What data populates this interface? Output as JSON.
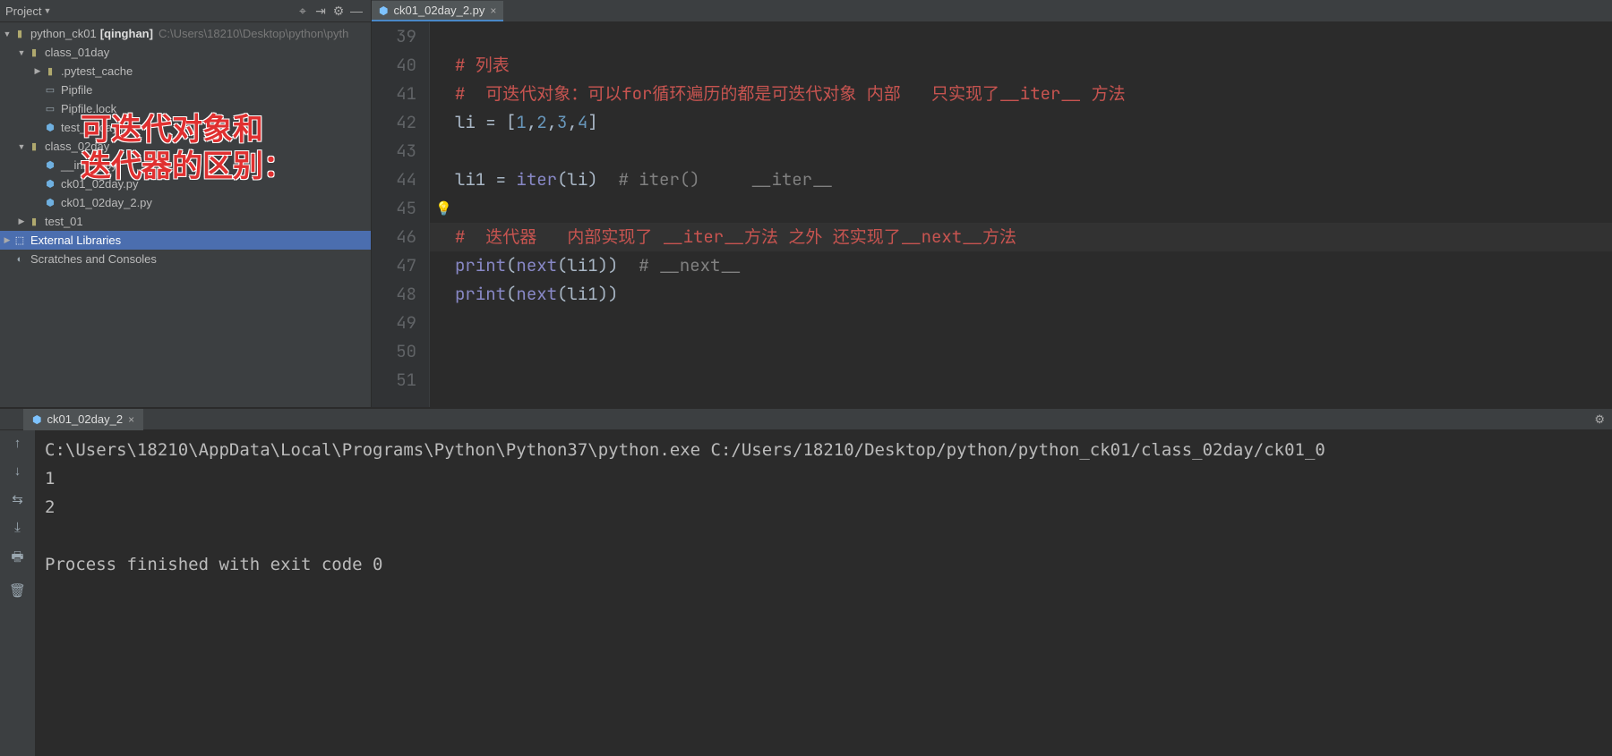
{
  "project_panel": {
    "title": "Project",
    "root": {
      "name": "python_ck01",
      "tag": "[qinghan]",
      "path": "C:\\Users\\18210\\Desktop\\python\\pyth"
    },
    "tree": [
      {
        "indent": 1,
        "arrow": "down",
        "icon": "folder",
        "label": "class_01day"
      },
      {
        "indent": 2,
        "arrow": "right",
        "icon": "folder",
        "label": ".pytest_cache"
      },
      {
        "indent": 2,
        "arrow": "",
        "icon": "file",
        "label": "Pipfile"
      },
      {
        "indent": 2,
        "arrow": "",
        "icon": "file",
        "label": "Pipfile.lock"
      },
      {
        "indent": 2,
        "arrow": "",
        "icon": "py",
        "label": "test_01day.py"
      },
      {
        "indent": 1,
        "arrow": "down",
        "icon": "folder",
        "label": "class_02day"
      },
      {
        "indent": 2,
        "arrow": "",
        "icon": "py",
        "label": "__init__.py"
      },
      {
        "indent": 2,
        "arrow": "",
        "icon": "py",
        "label": "ck01_02day.py"
      },
      {
        "indent": 2,
        "arrow": "",
        "icon": "py",
        "label": "ck01_02day_2.py"
      },
      {
        "indent": 1,
        "arrow": "right",
        "icon": "folder",
        "label": "test_01"
      },
      {
        "indent": 0,
        "arrow": "right",
        "icon": "lib",
        "label": "External Libraries",
        "selected": true
      },
      {
        "indent": 0,
        "arrow": "",
        "icon": "scratch",
        "label": "Scratches and Consoles"
      }
    ],
    "overlay_line1": "可迭代对象和",
    "overlay_line2": "迭代器的区别："
  },
  "editor": {
    "tab_name": "ck01_02day_2.py",
    "lines": {
      "39": "",
      "40": "# 列表",
      "41": "#  可迭代对象：可以for循环遍历的都是可迭代对象 内部   只实现了__iter__ 方法",
      "42_pre": "li ",
      "42_eq": "= ",
      "42_br1": "[",
      "42_n1": "1",
      "42_c1": ",",
      "42_n2": "2",
      "42_c2": ",",
      "42_n3": "3",
      "42_c3": ",",
      "42_n4": "4",
      "42_br2": "]",
      "43": "",
      "44_pre": "li1 ",
      "44_eq": "= ",
      "44_fn": "iter",
      "44_paren": "(li)",
      "44_cmt": "  # iter()     __iter__",
      "45": "",
      "46": "#  迭代器   内部实现了 __iter__方法 之外 还实现了__next__方法",
      "47_pr": "print",
      "47_p1": "(",
      "47_nx": "next",
      "47_p2": "(li1))",
      "47_cmt": "  # __next__",
      "48_pr": "print",
      "48_p1": "(",
      "48_nx": "next",
      "48_p2": "(li1))",
      "49": "",
      "50": "",
      "51": ""
    },
    "gutter": [
      "39",
      "40",
      "41",
      "42",
      "43",
      "44",
      "45",
      "46",
      "47",
      "48",
      "49",
      "50",
      "51"
    ]
  },
  "run": {
    "tab": "ck01_02day_2",
    "lines": [
      "C:\\Users\\18210\\AppData\\Local\\Programs\\Python\\Python37\\python.exe C:/Users/18210/Desktop/python/python_ck01/class_02day/ck01_0",
      "1",
      "2",
      "",
      "Process finished with exit code 0"
    ]
  }
}
